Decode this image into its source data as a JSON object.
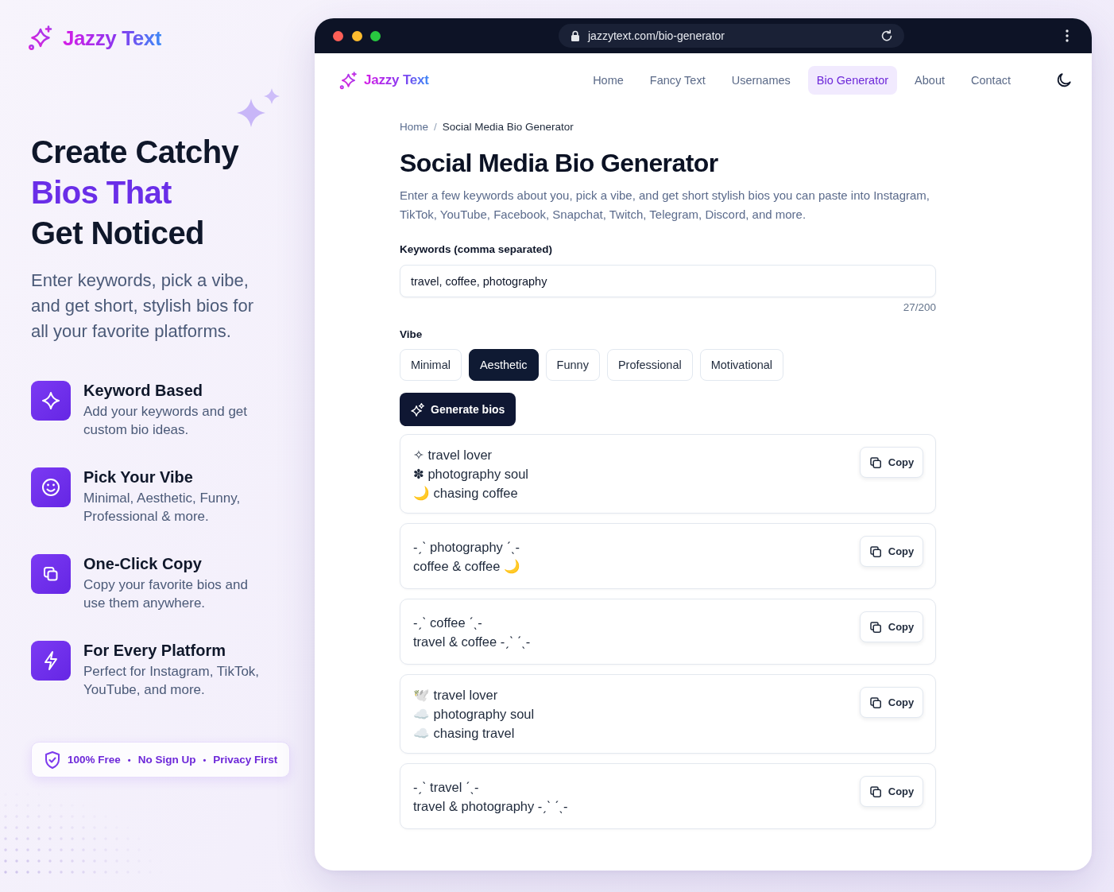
{
  "brand": {
    "name": "Jazzy Text"
  },
  "hero": {
    "headline": [
      {
        "text": "Create Catchy",
        "highlight": false
      },
      {
        "text": "Bios That",
        "highlight": true
      },
      {
        "text": "Get Noticed",
        "highlight": false
      }
    ],
    "subtitle": "Enter keywords, pick a vibe, and get short, stylish bios for all your favorite platforms."
  },
  "features": [
    {
      "title": "Keyword Based",
      "description": "Add your keywords and get custom bio ideas."
    },
    {
      "title": "Pick Your Vibe",
      "description": "Minimal, Aesthetic, Funny, Professional & more."
    },
    {
      "title": "One-Click Copy",
      "description": "Copy your favorite bios and use them anywhere."
    },
    {
      "title": "For Every Platform",
      "description": "Perfect for Instagram, TikTok, YouTube, and more."
    }
  ],
  "trust_badge": {
    "parts": [
      {
        "kind": "label",
        "text": "100% Free"
      },
      {
        "kind": "bullet",
        "text": "•"
      },
      {
        "kind": "label",
        "text": "No Sign Up"
      },
      {
        "kind": "bullet",
        "text": "•"
      },
      {
        "kind": "label",
        "text": "Privacy First"
      }
    ]
  },
  "browser": {
    "window_controls": [
      {
        "color": "#fe5f57"
      },
      {
        "color": "#febc2e"
      },
      {
        "color": "#28c840"
      }
    ],
    "url": "jazzytext.com/bio-generator"
  },
  "site": {
    "brand": "Jazzy Text",
    "nav": [
      {
        "label": "Home",
        "selected": false
      },
      {
        "label": "Fancy Text",
        "selected": false
      },
      {
        "label": "Usernames",
        "selected": false
      },
      {
        "label": "Bio Generator",
        "selected": true
      },
      {
        "label": "About",
        "selected": false
      },
      {
        "label": "Contact",
        "selected": false
      }
    ]
  },
  "page": {
    "breadcrumb": [
      {
        "kind": "link",
        "text": "Home"
      },
      {
        "kind": "separator",
        "text": "/"
      },
      {
        "kind": "current",
        "text": "Social Media Bio Generator"
      }
    ],
    "title": "Social Media Bio Generator",
    "description": "Enter a few keywords about you, pick a vibe, and get short stylish bios you can paste into Instagram, TikTok, YouTube, Facebook, Snapchat, Twitch, Telegram, Discord, and more.",
    "keywords": {
      "label": "Keywords (comma separated)",
      "value": "travel, coffee, photography",
      "counter": "27/200"
    },
    "vibe": {
      "label": "Vibe",
      "options": [
        {
          "label": "Minimal",
          "selected": false
        },
        {
          "label": "Aesthetic",
          "selected": true
        },
        {
          "label": "Funny",
          "selected": false
        },
        {
          "label": "Professional",
          "selected": false
        },
        {
          "label": "Motivational",
          "selected": false
        }
      ]
    },
    "generate_button": "Generate bios",
    "bios": [
      {
        "lines": [
          "✧ travel lover",
          "✽ photography soul",
          "🌙 chasing coffee"
        ],
        "copy_label": "Copy"
      },
      {
        "lines": [
          "-ˏˋ photography ˊˎ-",
          "coffee & coffee 🌙"
        ],
        "copy_label": "Copy"
      },
      {
        "lines": [
          "-ˏˋ coffee ˊˎ-",
          "travel & coffee -ˏˋ ˊˎ-"
        ],
        "copy_label": "Copy"
      },
      {
        "lines": [
          "🕊️ travel lover",
          "☁️ photography soul",
          "☁️ chasing travel"
        ],
        "copy_label": "Copy"
      },
      {
        "lines": [
          "-ˏˋ travel ˊˎ-",
          "travel & photography -ˏˋ ˊˎ-"
        ],
        "copy_label": "Copy"
      }
    ]
  }
}
